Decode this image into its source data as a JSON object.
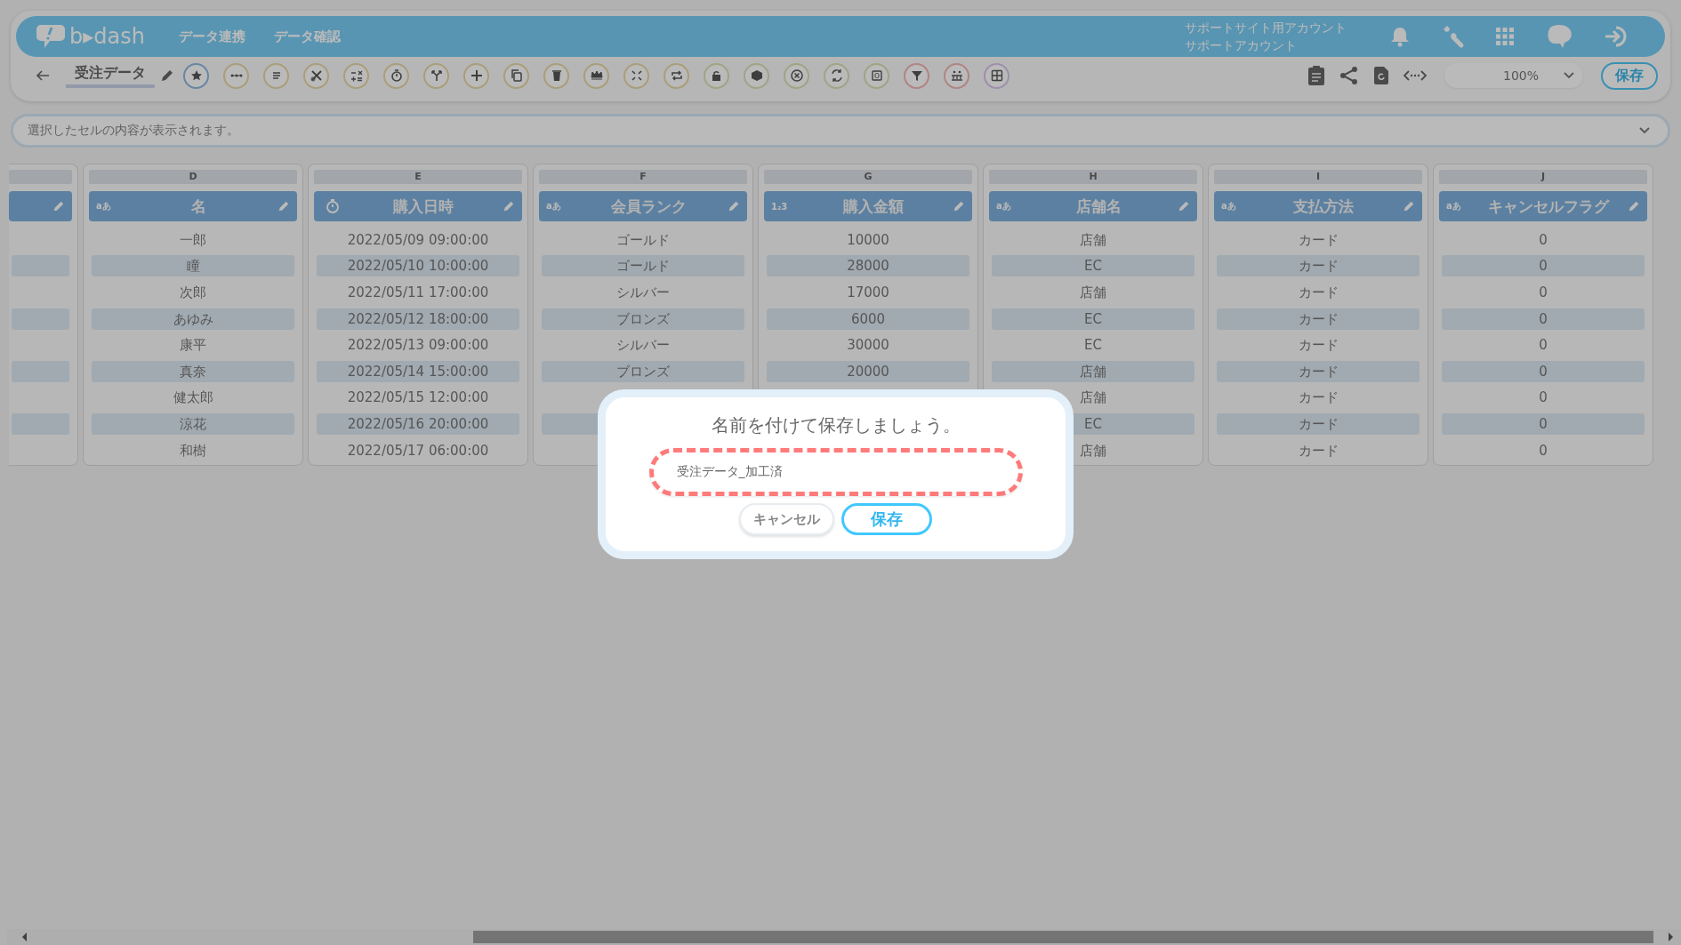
{
  "app": {
    "logo": "b▸dash",
    "nav": [
      {
        "label": "データ連携"
      },
      {
        "label": "データ確認"
      }
    ],
    "account": {
      "site": "サポートサイト用アカウント",
      "name": "サポートアカウント"
    }
  },
  "toolbar": {
    "title": "受注データ",
    "zoom": "100%",
    "save": "保存"
  },
  "formula_bar": {
    "placeholder": "選択したセルの内容が表示されます。"
  },
  "table": {
    "columns": [
      {
        "letter": "D",
        "name": "名",
        "kind": "text",
        "badge": "aあ"
      },
      {
        "letter": "E",
        "name": "購入日時",
        "kind": "date"
      },
      {
        "letter": "F",
        "name": "会員ランク",
        "kind": "text",
        "badge": "aあ"
      },
      {
        "letter": "G",
        "name": "購入金額",
        "kind": "number",
        "badge": "1₂3"
      },
      {
        "letter": "H",
        "name": "店舗名",
        "kind": "text",
        "badge": "aあ"
      },
      {
        "letter": "I",
        "name": "支払方法",
        "kind": "text",
        "badge": "aあ"
      },
      {
        "letter": "J",
        "name": "キャンセルフラグ",
        "kind": "text",
        "badge": "aあ"
      }
    ],
    "rows": [
      [
        "一郎",
        "2022/05/09 09:00:00",
        "ゴールド",
        "10000",
        "店舗",
        "カード",
        "0"
      ],
      [
        "瞳",
        "2022/05/10 10:00:00",
        "ゴールド",
        "28000",
        "EC",
        "カード",
        "0"
      ],
      [
        "次郎",
        "2022/05/11 17:00:00",
        "シルバー",
        "17000",
        "店舗",
        "カード",
        "0"
      ],
      [
        "あゆみ",
        "2022/05/12 18:00:00",
        "ブロンズ",
        "6000",
        "EC",
        "カード",
        "0"
      ],
      [
        "康平",
        "2022/05/13 09:00:00",
        "シルバー",
        "30000",
        "EC",
        "カード",
        "0"
      ],
      [
        "真奈",
        "2022/05/14 15:00:00",
        "ブロンズ",
        "20000",
        "店舗",
        "カード",
        "0"
      ],
      [
        "健太郎",
        "2022/05/15 12:00:00",
        null,
        null,
        "店舗",
        "カード",
        "0"
      ],
      [
        "涼花",
        "2022/05/16 20:00:00",
        null,
        null,
        "EC",
        "カード",
        "0"
      ],
      [
        "和樹",
        "2022/05/17 06:00:00",
        null,
        null,
        "店舗",
        "カード",
        "0"
      ]
    ]
  },
  "dialog": {
    "title": "名前を付けて保存しましょう。",
    "input": {
      "value": "受注データ_加工済",
      "highlighted": true
    },
    "buttons": [
      {
        "label": "キャンセル",
        "kind": "cancel"
      },
      {
        "label": "保存",
        "kind": "primary"
      }
    ]
  }
}
